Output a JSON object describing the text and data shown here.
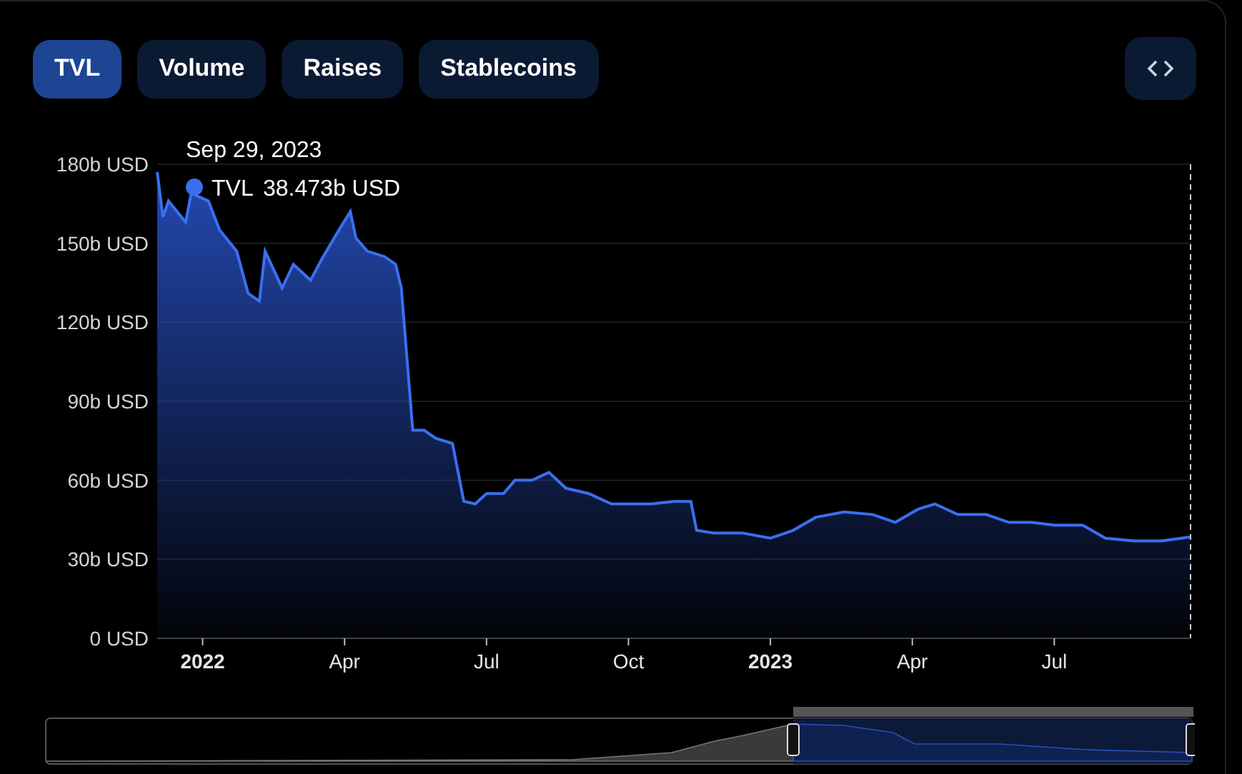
{
  "tabs": [
    {
      "label": "TVL",
      "selected": true
    },
    {
      "label": "Volume",
      "selected": false
    },
    {
      "label": "Raises",
      "selected": false
    },
    {
      "label": "Stablecoins",
      "selected": false
    }
  ],
  "tooltip": {
    "date": "Sep 29, 2023",
    "value": "38.473b USD"
  },
  "chart_data": {
    "type": "area",
    "grid": true,
    "xlim": [
      2021.92,
      2023.74
    ],
    "ylim": [
      0,
      180
    ],
    "xticks": [
      {
        "value": 2022,
        "label": "2022"
      },
      {
        "value": 2022.25,
        "label": "Apr"
      },
      {
        "value": 2022.5,
        "label": "Jul"
      },
      {
        "value": 2022.75,
        "label": "Oct"
      },
      {
        "value": 2023,
        "label": "2023"
      },
      {
        "value": 2023.25,
        "label": "Apr"
      },
      {
        "value": 2023.5,
        "label": "Jul"
      }
    ],
    "yticks": [
      {
        "value": 0,
        "label": "0 USD"
      },
      {
        "value": 30,
        "label": "30b USD"
      },
      {
        "value": 60,
        "label": "60b USD"
      },
      {
        "value": 90,
        "label": "90b USD"
      },
      {
        "value": 120,
        "label": "120b USD"
      },
      {
        "value": 150,
        "label": "150b USD"
      },
      {
        "value": 180,
        "label": "180b USD"
      }
    ],
    "x": [
      2021.92,
      2021.93,
      2021.94,
      2021.97,
      2021.98,
      2022.01,
      2022.03,
      2022.06,
      2022.08,
      2022.1,
      2022.11,
      2022.14,
      2022.16,
      2022.19,
      2022.21,
      2022.24,
      2022.26,
      2022.27,
      2022.29,
      2022.32,
      2022.34,
      2022.35,
      2022.37,
      2022.39,
      2022.41,
      2022.44,
      2022.46,
      2022.48,
      2022.5,
      2022.53,
      2022.55,
      2022.58,
      2022.61,
      2022.64,
      2022.68,
      2022.72,
      2022.75,
      2022.79,
      2022.83,
      2022.86,
      2022.87,
      2022.9,
      2022.95,
      2023.0,
      2023.04,
      2023.08,
      2023.13,
      2023.18,
      2023.22,
      2023.26,
      2023.29,
      2023.33,
      2023.38,
      2023.42,
      2023.46,
      2023.5,
      2023.55,
      2023.59,
      2023.64,
      2023.69,
      2023.74
    ],
    "series": [
      {
        "name": "TVL",
        "color": "#3b6ff0",
        "values": [
          177,
          160,
          166,
          158,
          169,
          166,
          155,
          147,
          131,
          128,
          147,
          133,
          142,
          136,
          144,
          155,
          162,
          152,
          147,
          145,
          142,
          133,
          79,
          79,
          76,
          74,
          52,
          51,
          55,
          55,
          60,
          60,
          63,
          57,
          55,
          51,
          51,
          51,
          52,
          52,
          41,
          40,
          40,
          38,
          41,
          46,
          48,
          47,
          44,
          49,
          51,
          47,
          47,
          44,
          44,
          43,
          43,
          38,
          37,
          37,
          38.5
        ]
      }
    ]
  }
}
